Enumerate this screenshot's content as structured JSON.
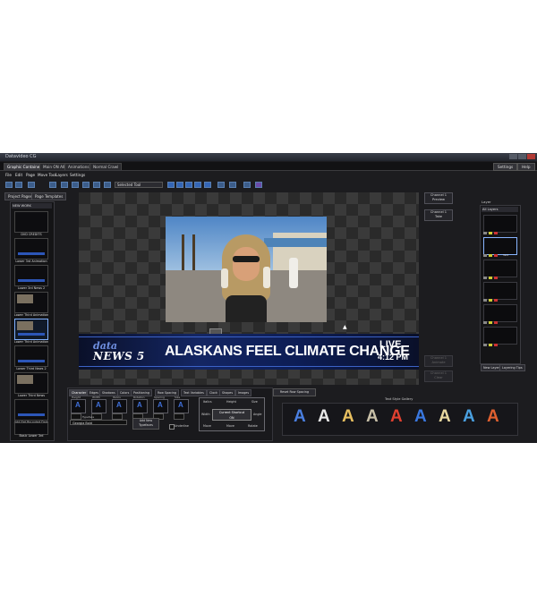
{
  "window": {
    "title": "Datavideo CG",
    "controls": [
      "min",
      "max",
      "close"
    ]
  },
  "tabs": [
    "Graphic Container",
    "Main ON AIR",
    "Animations",
    "Normal Crawl"
  ],
  "top_buttons": {
    "settings": "Settings",
    "help": "Help"
  },
  "menu": [
    "File",
    "Edit",
    "Page",
    "Move Tool",
    "Layers",
    "Settings"
  ],
  "toolbar": {
    "dropdown": "Selected Tool"
  },
  "left_tabs": [
    "Project Pages",
    "Page Templates"
  ],
  "left_panel": {
    "header": "NEW WORK",
    "pages": [
      {
        "label": "DVD CREDITS"
      },
      {
        "label": "Lower 3rd Animation"
      },
      {
        "label": "Lower 3rd News 2"
      },
      {
        "label": "Lower Third Animation"
      },
      {
        "label": "Lower Third Animation"
      },
      {
        "label": "Lower Third News 2"
      },
      {
        "label": "Lower Third News"
      },
      {
        "label": "Add Set Rounded Dark"
      },
      {
        "label": "Basic Lower 3rd"
      }
    ]
  },
  "preview": {
    "brand_top": "data",
    "brand_bottom": "NEWS 5",
    "headline": "ALASKANS FEEL CLIMATE CHANGE",
    "live": "LIVE",
    "time": "4:12 PM"
  },
  "right_buttons": [
    {
      "label1": "Channel 1",
      "label2": "Preview"
    },
    {
      "label1": "Channel 1",
      "label2": "Take"
    },
    {
      "label1": "Channel 1",
      "label2": "Animate"
    },
    {
      "label1": "Channel 1",
      "label2": "Clear"
    }
  ],
  "layers": {
    "title": "Layer",
    "header": "All Layers",
    "selected_label": "Text",
    "new_layer": "New Layer",
    "layering_tips": "Layering Tips"
  },
  "props_tabs": [
    "Character",
    "Edges",
    "Shadows",
    "Colors",
    "Positioning",
    "Row Spacing",
    "Text Variables",
    "Clock",
    "Shapes",
    "Images"
  ],
  "props": {
    "swatch_labels": [
      "Height",
      "Width",
      "Italics",
      "Rotation",
      "Spacing",
      "Size"
    ],
    "swatch_glyph": "A",
    "typeface_label": "Typeface",
    "typeface": "Georgia Bold",
    "add_typefaces_1": "Add New",
    "add_typefaces_2": "Typefaces",
    "underline": "Underline",
    "position": {
      "top_left": "Italics",
      "top_mid": "Height",
      "top_right": "Size",
      "left": "Width",
      "right": "Angle",
      "bottom_left": "Move",
      "bottom_mid": "Move",
      "bottom_right": "Rotate",
      "center_1": "Current Shortcut",
      "center_2": "ON"
    }
  },
  "reset_row_spacing": "Reset Row Spacing",
  "text_style_gallery": {
    "title": "Text Style Gallery",
    "glyph": "A",
    "colors": [
      "#4a7fe0",
      "#e8e8e8",
      "#e8c060",
      "#c8c0a8",
      "#e04030",
      "#3a78e0",
      "#e8d8a0",
      "#4aa0e0",
      "#e06030"
    ]
  }
}
